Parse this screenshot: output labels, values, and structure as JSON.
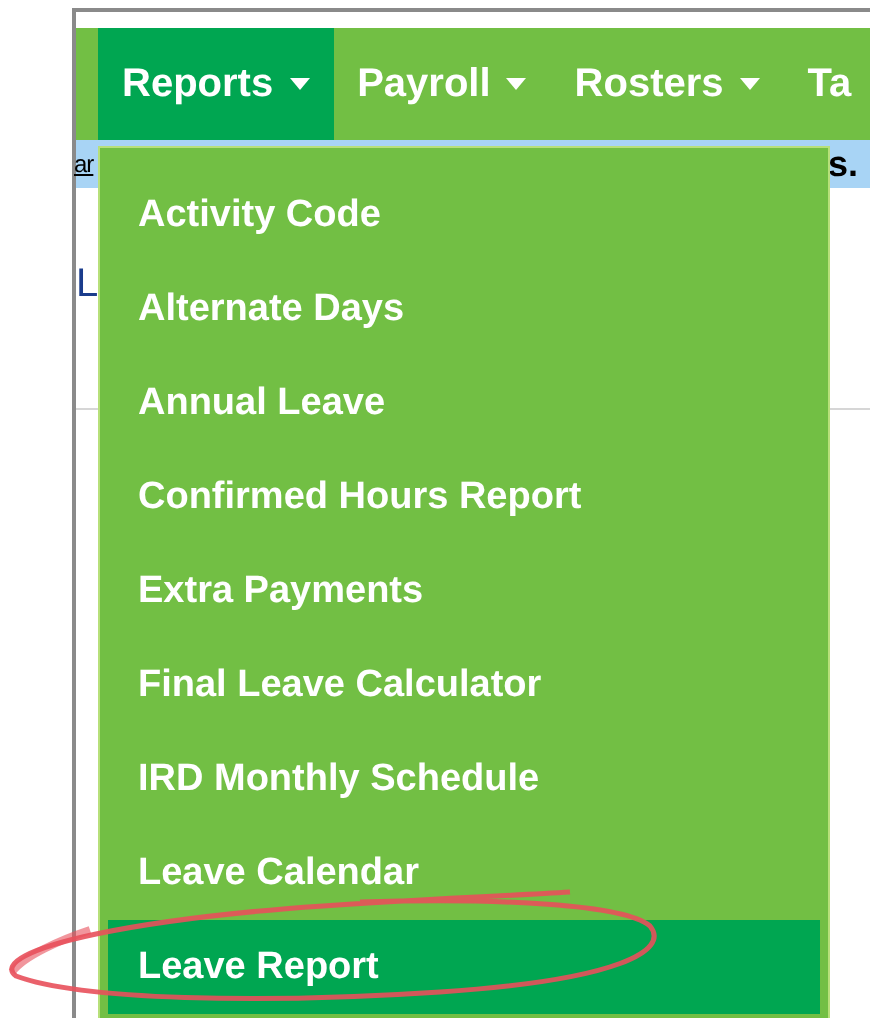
{
  "nav": {
    "items": [
      {
        "label": "Reports",
        "caret": true,
        "selected": true
      },
      {
        "label": "Payroll",
        "caret": true,
        "selected": false
      },
      {
        "label": "Rosters",
        "caret": true,
        "selected": false
      },
      {
        "label": "Ta",
        "caret": false,
        "selected": false
      }
    ]
  },
  "notice": {
    "left": "ar",
    "right": "s."
  },
  "content": {
    "text": "L"
  },
  "dropdown": {
    "items": [
      {
        "label": "Activity Code",
        "selected": false
      },
      {
        "label": "Alternate Days",
        "selected": false
      },
      {
        "label": "Annual Leave",
        "selected": false
      },
      {
        "label": "Confirmed Hours Report",
        "selected": false
      },
      {
        "label": "Extra Payments",
        "selected": false
      },
      {
        "label": "Final Leave Calculator",
        "selected": false
      },
      {
        "label": "IRD Monthly Schedule",
        "selected": false
      },
      {
        "label": "Leave Calendar",
        "selected": false
      },
      {
        "label": "Leave Report",
        "selected": true
      }
    ]
  }
}
